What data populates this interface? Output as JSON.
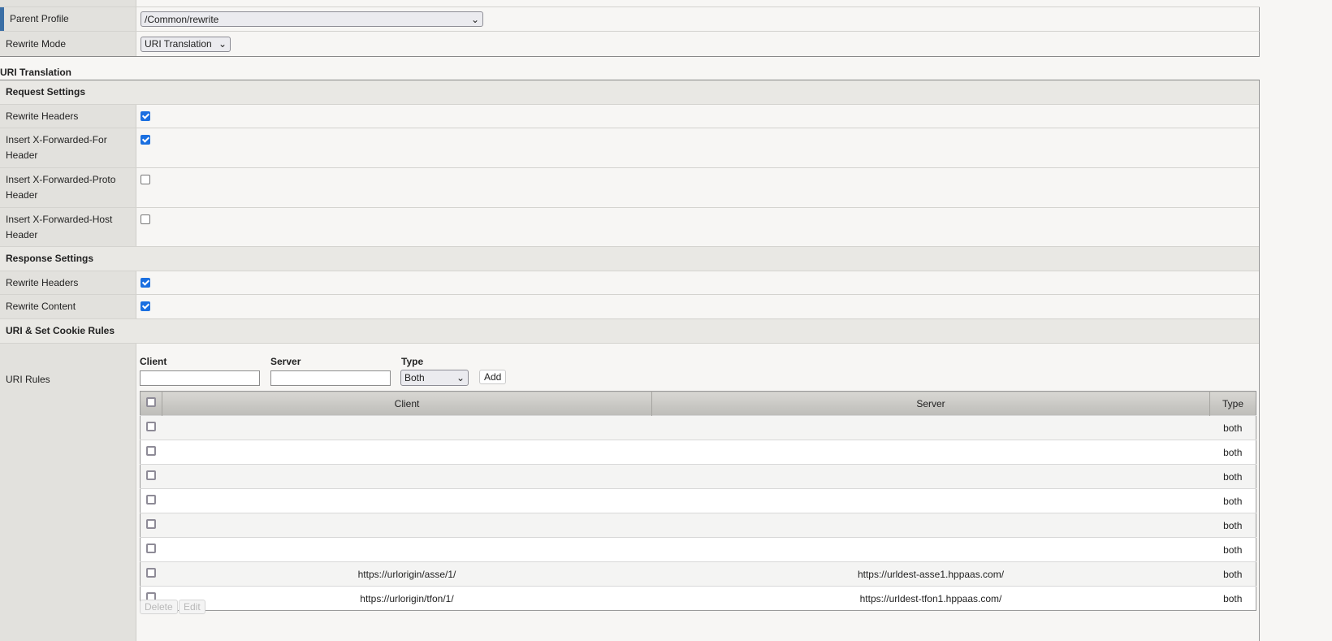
{
  "general": {
    "parent_profile_label": "Parent Profile",
    "parent_profile_value": "/Common/rewrite",
    "rewrite_mode_label": "Rewrite Mode",
    "rewrite_mode_value": "URI Translation"
  },
  "uri_translation_title": "URI Translation",
  "request": {
    "title": "Request Settings",
    "rows": [
      {
        "label": "Rewrite Headers",
        "checked": true
      },
      {
        "label": "Insert X-Forwarded-For Header",
        "checked": true
      },
      {
        "label": "Insert X-Forwarded-Proto Header",
        "checked": false
      },
      {
        "label": "Insert X-Forwarded-Host Header",
        "checked": false
      }
    ]
  },
  "response": {
    "title": "Response Settings",
    "rows": [
      {
        "label": "Rewrite Headers",
        "checked": true
      },
      {
        "label": "Rewrite Content",
        "checked": true
      }
    ]
  },
  "rules": {
    "title": "URI & Set Cookie Rules",
    "label": "URI Rules",
    "client_label": "Client",
    "server_label": "Server",
    "type_label": "Type",
    "client_value": "",
    "server_value": "",
    "type_value": "Both",
    "add": "Add",
    "columns": [
      "Client",
      "Server",
      "Type"
    ],
    "rows": [
      {
        "client": "",
        "server": "",
        "type": "both"
      },
      {
        "client": "",
        "server": "",
        "type": "both"
      },
      {
        "client": "",
        "server": "",
        "type": "both"
      },
      {
        "client": "",
        "server": "",
        "type": "both"
      },
      {
        "client": "",
        "server": "",
        "type": "both"
      },
      {
        "client": "",
        "server": "",
        "type": "both"
      },
      {
        "client": "https://urlorigin/asse/1/",
        "server": "https://urldest-asse1.hppaas.com/",
        "type": "both"
      },
      {
        "client": "https://urlorigin/tfon/1/",
        "server": "https://urldest-tfon1.hppaas.com/",
        "type": "both"
      }
    ],
    "delete": "Delete",
    "edit": "Edit"
  }
}
